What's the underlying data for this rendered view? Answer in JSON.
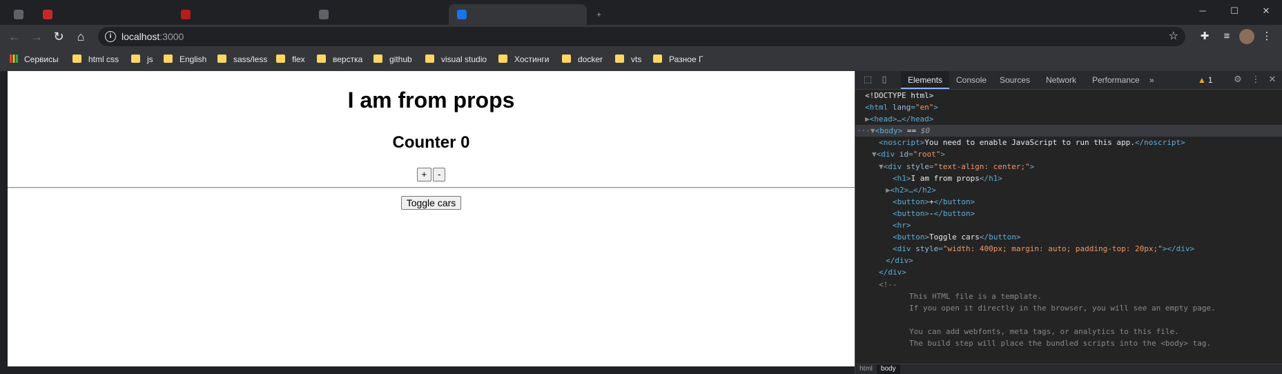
{
  "browser": {
    "tabs": [
      {
        "title": "",
        "fav_color": "#5f6368"
      },
      {
        "title": "",
        "fav_color": "#c62828"
      },
      {
        "title": "",
        "fav_color": "#b71c1c"
      },
      {
        "title": "",
        "fav_color": "#5f6368"
      },
      {
        "title": "",
        "fav_color": "#1a73e8"
      }
    ],
    "url_host": "localhost",
    "url_port": ":3000",
    "bookmarks": [
      {
        "label": "Сервисы",
        "icon": "apps-icon"
      },
      {
        "label": "html css",
        "icon": "folder-icon"
      },
      {
        "label": "js",
        "icon": "folder-icon"
      },
      {
        "label": "English",
        "icon": "folder-icon"
      },
      {
        "label": "sass/less",
        "icon": "folder-icon"
      },
      {
        "label": "flex",
        "icon": "folder-icon"
      },
      {
        "label": "верстка",
        "icon": "folder-icon"
      },
      {
        "label": "github",
        "icon": "folder-icon"
      },
      {
        "label": "visual studio",
        "icon": "folder-icon"
      },
      {
        "label": "Хостинги",
        "icon": "folder-icon"
      },
      {
        "label": "docker",
        "icon": "folder-icon"
      },
      {
        "label": "vts",
        "icon": "folder-icon"
      },
      {
        "label": "Разное Г",
        "icon": "folder-icon"
      }
    ]
  },
  "page": {
    "h1": "I am from props",
    "h2": "Counter 0",
    "plus_label": "+",
    "minus_label": "-",
    "toggle_label": "Toggle cars"
  },
  "devtools": {
    "tabs": [
      "Elements",
      "Console",
      "Sources",
      "Network",
      "Performance"
    ],
    "more": "»",
    "warning_count": "1",
    "code": {
      "doctype": "<!DOCTYPE html>",
      "html_open": "<html",
      "html_attr": "lang",
      "html_val": "\"en\"",
      "head": "<head>…</head>",
      "body_tag": "<body>",
      "body_eq": " == ",
      "body_var": "$0",
      "noscript_open": "<noscript>",
      "noscript_text": "You need to enable JavaScript to run this app.",
      "noscript_close": "</noscript>",
      "div_root_open": "<div",
      "div_root_attr": "id",
      "div_root_val": "\"root\"",
      "div_style_open": "<div",
      "div_style_attr": "style",
      "div_style_val": "\"text-align: center;\"",
      "h1_open": "<h1>",
      "h1_text": "I am from props",
      "h1_close": "</h1>",
      "h2": "<h2>…</h2>",
      "button_open": "<button>",
      "button_close": "</button>",
      "plus": "+",
      "minus": "-",
      "hr": "<hr>",
      "toggle_text": "Toggle cars",
      "div_inner_open": "<div",
      "div_inner_attr": "style",
      "div_inner_val": "\"width: 400px; margin: auto; padding-top: 20px;\"",
      "div_inner_close": "</div>",
      "div_close": "</div>",
      "comment_open": "<!--",
      "comment_1": "This HTML file is a template.",
      "comment_2": "If you open it directly in the browser, you will see an empty page.",
      "comment_3": "You can add webfonts, meta tags, or analytics to this file.",
      "comment_4": "The build step will place the bundled scripts into the <body> tag."
    },
    "breadcrumbs": [
      "html",
      "body"
    ]
  }
}
